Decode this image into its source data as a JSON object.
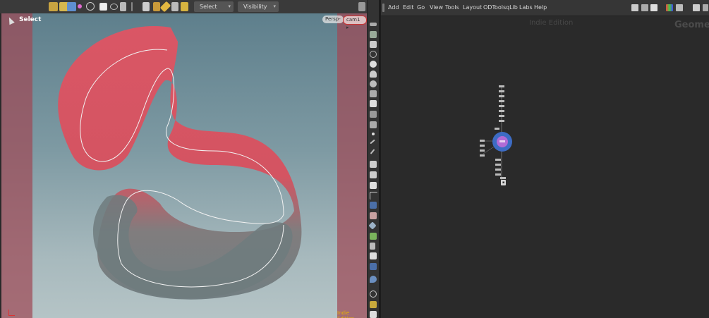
{
  "viewport": {
    "toolbar": {
      "select_dropdown": "Select",
      "visibility_dropdown": "Visibility"
    },
    "mode_label": "Select",
    "persp_label": "Persp-",
    "camera_label": "cam1",
    "watermark": "Indie Edition"
  },
  "network": {
    "menu": [
      "Add",
      "Edit",
      "Go",
      "View",
      "Tools",
      "Layout",
      "ODTools",
      "qLib",
      "Labs",
      "Help"
    ],
    "watermark": "Indie Edition",
    "context_label": "Geomet",
    "selected_node_tag": "▪"
  },
  "colors": {
    "ribbon_red": "#e05463",
    "ribbon_grey": "#6e7b7e",
    "mask": "#9e4a56",
    "node_ring": "#3d6cc4",
    "node_fill": "#b06bd6",
    "watermark_yellow": "#e8b400"
  }
}
